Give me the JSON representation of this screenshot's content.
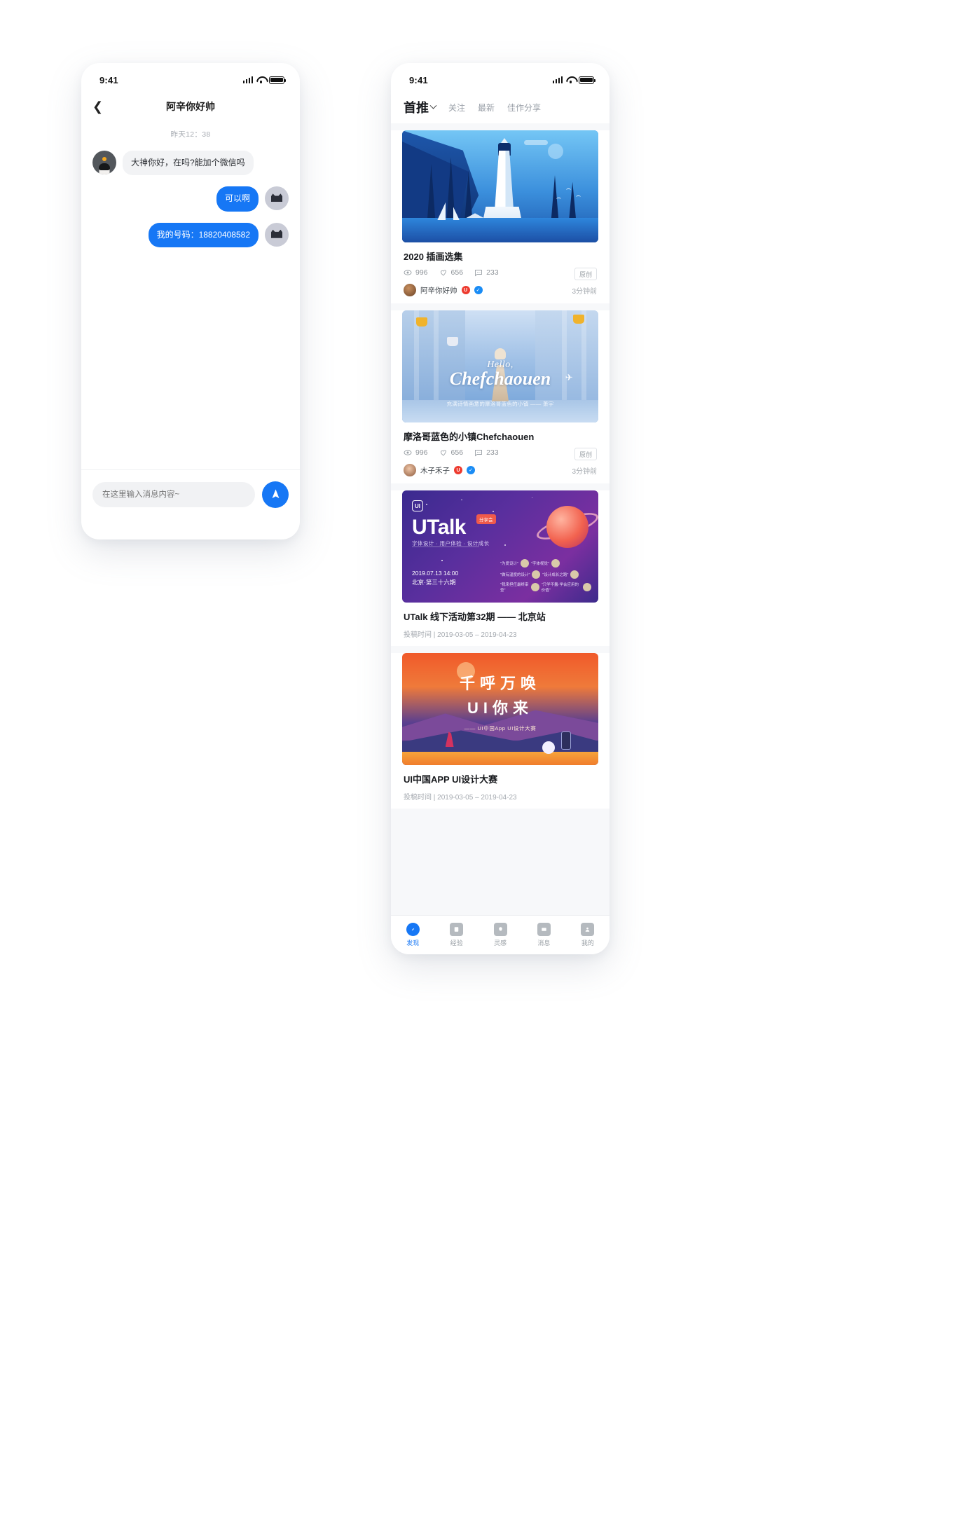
{
  "status_bar": {
    "time": "9:41"
  },
  "chat_screen": {
    "nav": {
      "back_icon": "chevron-left-icon",
      "title": "阿辛你好帅"
    },
    "timestamp": "昨天12：38",
    "messages": [
      {
        "side": "in",
        "text": "大神你好，在吗?能加个微信吗",
        "avatar": "cat-dark"
      },
      {
        "side": "out",
        "text": "可以啊",
        "avatar": "cat-light"
      },
      {
        "side": "out",
        "text": "我的号码：18820408582",
        "avatar": "cat-light"
      }
    ],
    "input": {
      "placeholder": "在这里输入消息内容~",
      "value": ""
    },
    "send_button": {
      "icon": "send-paper-plane-icon",
      "color": "#1677f5"
    }
  },
  "feed_screen": {
    "tabs": [
      {
        "label": "首推",
        "active": true,
        "has_chevron": true
      },
      {
        "label": "关注",
        "active": false
      },
      {
        "label": "最新",
        "active": false
      },
      {
        "label": "佳作分享",
        "active": false
      }
    ],
    "cards": [
      {
        "illustration": "lighthouse-illustration",
        "title": "2020 插画选集",
        "views": "996",
        "likes": "656",
        "comments": "233",
        "tag": "原创",
        "author": "阿辛你好帅",
        "badges": [
          "U",
          "V"
        ],
        "time_ago": "3分钟前",
        "type": "post"
      },
      {
        "illustration": "chefchaouen-illustration",
        "illustration_text": {
          "line1": "Hello,",
          "line2": "Chefchaouen",
          "caption": "充满诗情画意的摩洛哥蓝色的小镇 —— 萧宇"
        },
        "title": "摩洛哥蓝色的小镇Chefchaouen",
        "views": "996",
        "likes": "656",
        "comments": "233",
        "tag": "原创",
        "author": "木子禾子",
        "badges": [
          "U",
          "V"
        ],
        "time_ago": "3分钟前",
        "type": "post"
      },
      {
        "illustration": "utalk-poster",
        "illustration_text": {
          "logo": "UI",
          "brand": "UTalk",
          "tag": "分享会",
          "subtitle": "字体设计 · 用户体验 · 设计成长",
          "date": "2019.07.13  14:00",
          "place": "北京·第三十六期",
          "quotes": [
            "\"为爱设计\"",
            "\"字体视觉\"",
            "\"做有温度的设计\"",
            "\"设计成长之路\"",
            "\"我来担任最终审查\"",
            "\"只学不蠢·学会应用的价值\""
          ]
        },
        "title": "UTalk 线下活动第32期 ——  北京站",
        "sub_meta": "投稿时间 | 2019-03-05 – 2019-04-23",
        "type": "event"
      },
      {
        "illustration": "ui-contest-poster",
        "illustration_text": {
          "line1": "千呼万唤",
          "line2": "UI你来",
          "caption": "—— UI中国App UI设计大赛"
        },
        "title": "UI中国APP UI设计大赛",
        "sub_meta": "投稿时间 | 2019-03-05 – 2019-04-23",
        "type": "event"
      }
    ],
    "tabbar": [
      {
        "label": "发现",
        "icon": "compass-icon",
        "active": true
      },
      {
        "label": "经验",
        "icon": "book-icon",
        "active": false
      },
      {
        "label": "灵感",
        "icon": "lightbulb-icon",
        "active": false
      },
      {
        "label": "消息",
        "icon": "message-icon",
        "active": false
      },
      {
        "label": "我的",
        "icon": "user-icon",
        "active": false
      }
    ]
  },
  "theme": {
    "accent": "#1677f5",
    "bg": "#f7f8fa",
    "muted": "#9aa0a6"
  }
}
